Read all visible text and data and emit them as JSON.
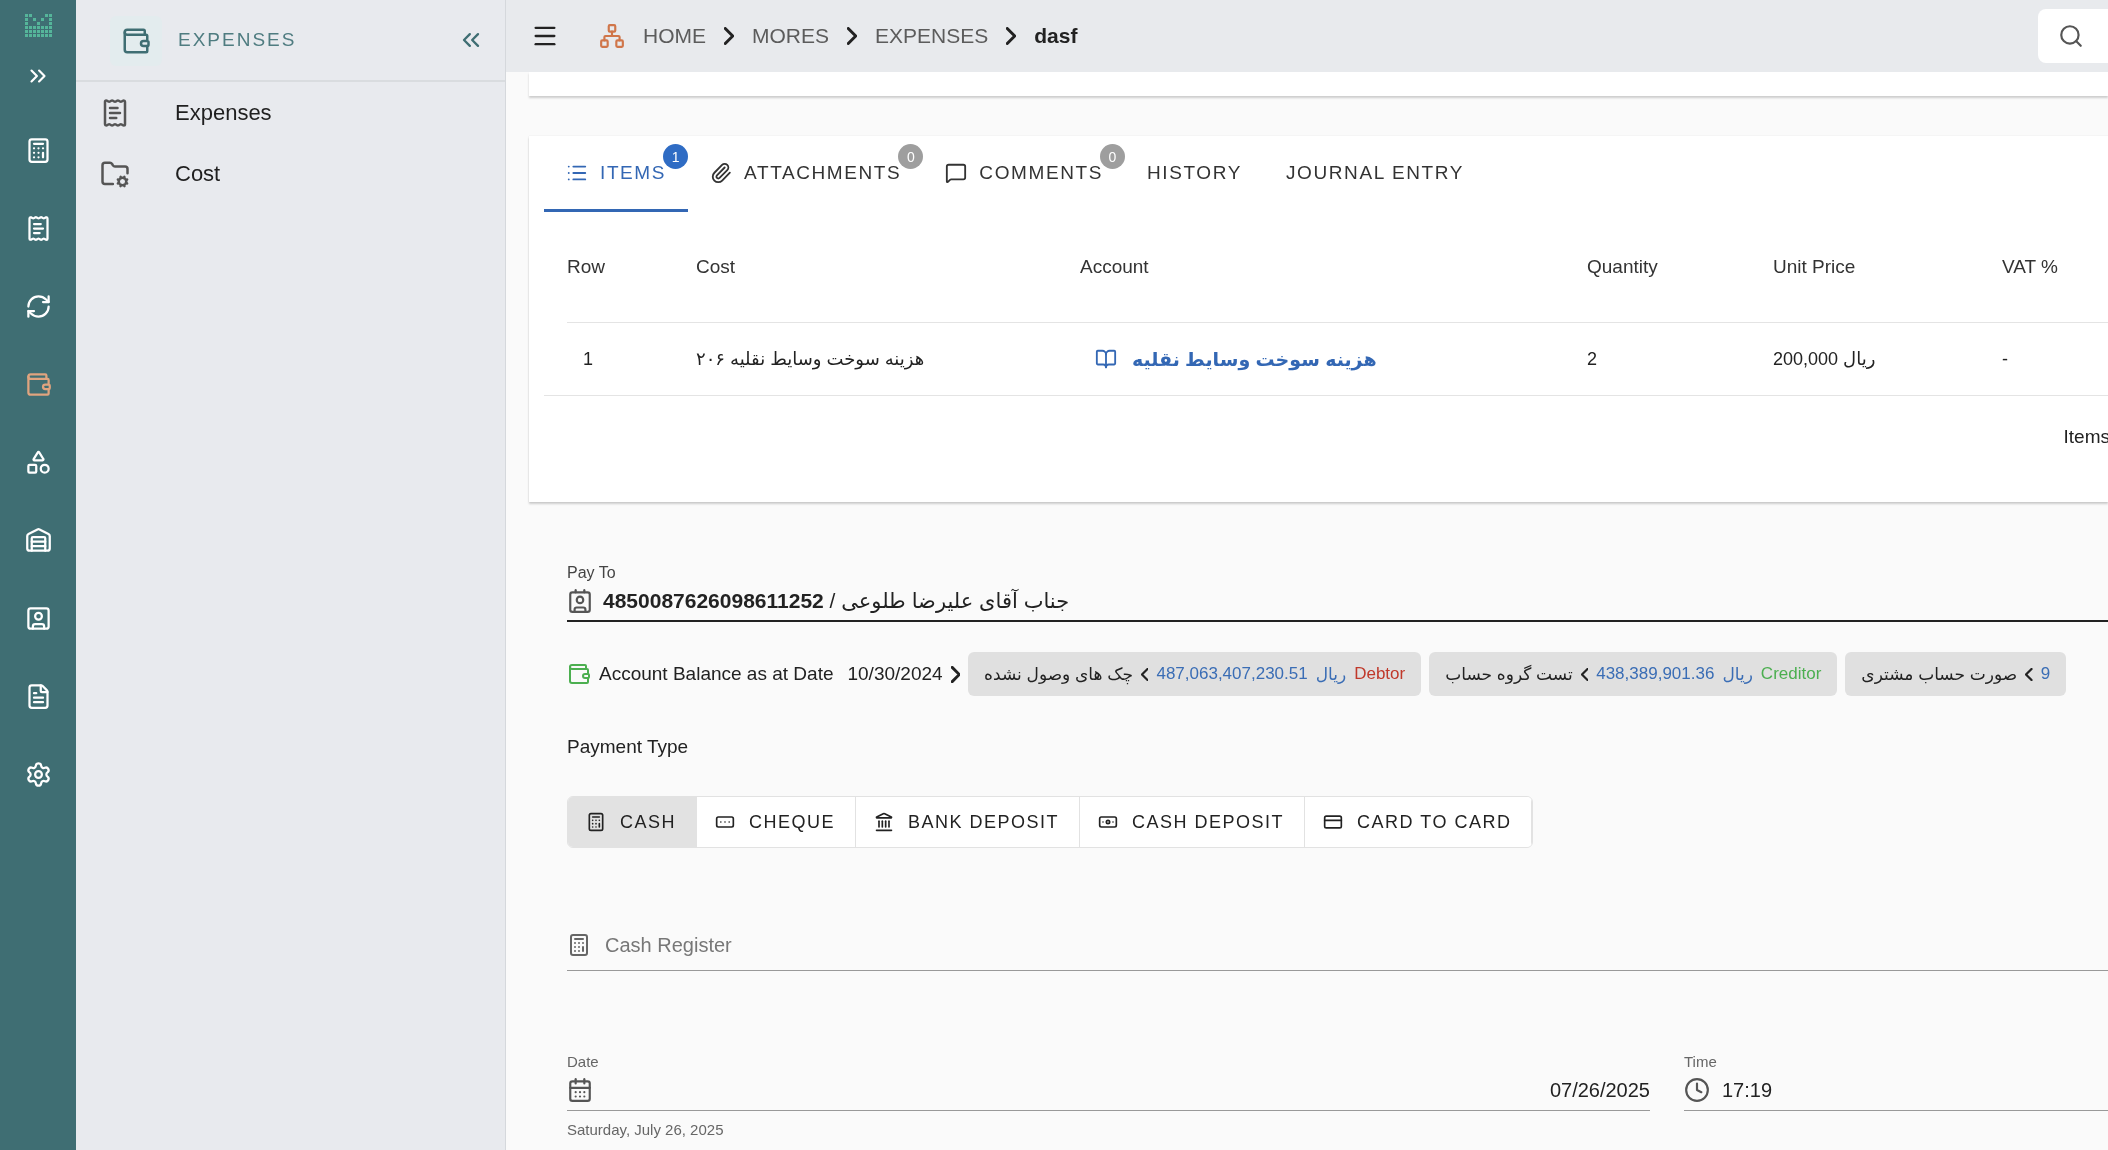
{
  "rail": {
    "items": [
      {
        "selected": false
      },
      {
        "selected": false
      },
      {
        "selected": false
      },
      {
        "selected": true
      },
      {
        "selected": false
      },
      {
        "selected": false
      },
      {
        "selected": false
      },
      {
        "selected": false
      },
      {
        "selected": false
      }
    ]
  },
  "sidebar": {
    "title": "EXPENSES",
    "items": [
      {
        "label": "Expenses"
      },
      {
        "label": "Cost"
      }
    ]
  },
  "breadcrumbs": [
    {
      "label": "HOME",
      "current": false
    },
    {
      "label": "MORES",
      "current": false
    },
    {
      "label": "EXPENSES",
      "current": false
    },
    {
      "label": "dasf",
      "current": true
    }
  ],
  "tabs": [
    {
      "label": "ITEMS",
      "badge": "1",
      "selected": true
    },
    {
      "label": "ATTACHMENTS",
      "badge": "0",
      "selected": false
    },
    {
      "label": "COMMENTS",
      "badge": "0",
      "selected": false
    },
    {
      "label": "HISTORY",
      "selected": false
    },
    {
      "label": "JOURNAL ENTRY",
      "selected": false
    }
  ],
  "table": {
    "columns": [
      "Row",
      "Cost",
      "Account",
      "Quantity",
      "Unit Price",
      "VAT %"
    ],
    "rows": [
      {
        "row": "1",
        "cost": "هزینه سوخت وسایط نقلیه ۲۰۶",
        "account": "هزینه سوخت وسایط نقلیه",
        "quantity": "2",
        "unit_price": "200,000 ریال",
        "vat": "-"
      }
    ],
    "footer": "Items"
  },
  "pay_to": {
    "label": "Pay To",
    "value": "**4850087626098611252** / جناب آقای علیرضا طلوعی"
  },
  "balance": {
    "label": "Account Balance as at Date",
    "date": "10/30/2024",
    "chip_1": {
      "name": "چک های وصول نشده",
      "amount": "487,063,407,230.51",
      "currency": "ریال",
      "status": "Debtor",
      "color": "#c0392b"
    },
    "chip_2": {
      "name": "تست گروه حساب",
      "amount": "438,389,901.36",
      "currency": "ریال",
      "status": "Creditor",
      "color": "#4caf50"
    },
    "chip_3": {
      "name": "صورت حساب مشتری",
      "amount": "9"
    }
  },
  "payment_type": {
    "label": "Payment Type",
    "options": [
      {
        "label": "CASH",
        "selected": true
      },
      {
        "label": "CHEQUE",
        "selected": false
      },
      {
        "label": "BANK DEPOSIT",
        "selected": false
      },
      {
        "label": "CASH DEPOSIT",
        "selected": false
      },
      {
        "label": "CARD TO CARD",
        "selected": false
      }
    ]
  },
  "cash_register": {
    "placeholder": "Cash Register"
  },
  "date": {
    "label": "Date",
    "value": "07/26/2025",
    "helper": "Saturday, July 26, 2025"
  },
  "time": {
    "label": "Time",
    "value": "17:19"
  }
}
